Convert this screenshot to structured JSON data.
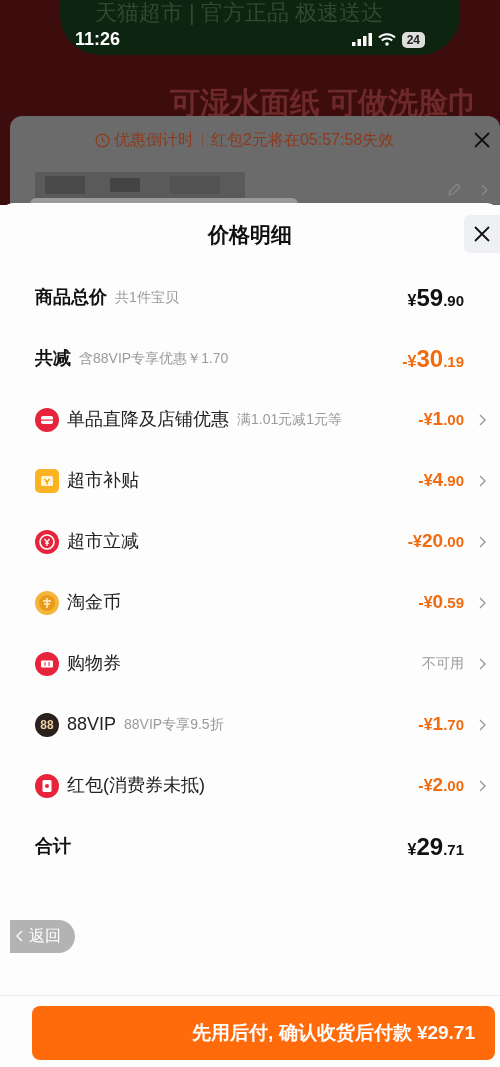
{
  "status_bar": {
    "time": "11:26",
    "battery": "24"
  },
  "background": {
    "banner_top": "天猫超市 | 官方正品 极速送达",
    "slogan": "可湿水面纸 可做洗脸巾"
  },
  "notice": {
    "label": "优惠倒计时",
    "text": "红包2元将在05:57:58失效"
  },
  "sheet": {
    "title": "价格明细",
    "rows": [
      {
        "kind": "summary",
        "label": "商品总价",
        "note": "共1件宝贝",
        "amount": "¥59.90",
        "discount": false,
        "chevron": false
      },
      {
        "kind": "summary",
        "label": "共减",
        "note": "含88VIP专享优惠￥1.70",
        "amount": "-¥30.19",
        "discount": true,
        "chevron": false
      },
      {
        "kind": "store",
        "label": "单品直降及店铺优惠",
        "note": "满1.01元减1元等",
        "amount": "-¥1.00",
        "discount": true,
        "chevron": true
      },
      {
        "kind": "subsidy",
        "label": "超市补贴",
        "amount": "-¥4.90",
        "discount": true,
        "chevron": true
      },
      {
        "kind": "instant",
        "label": "超市立减",
        "amount": "-¥20.00",
        "discount": true,
        "chevron": true
      },
      {
        "kind": "coin",
        "label": "淘金币",
        "amount": "-¥0.59",
        "discount": true,
        "chevron": true
      },
      {
        "kind": "ticket",
        "label": "购物券",
        "status": "不可用",
        "chevron": true
      },
      {
        "kind": "vip",
        "icon_text": "88",
        "label": "88VIP",
        "note": "88VIP专享9.5折",
        "amount": "-¥1.70",
        "discount": true,
        "chevron": true
      },
      {
        "kind": "packet",
        "label": "红包(消费券未抵)",
        "amount": "-¥2.00",
        "discount": true,
        "chevron": true
      },
      {
        "kind": "summary",
        "label": "合计",
        "amount": "¥29.71",
        "discount": false,
        "chevron": false
      }
    ],
    "back": "返回",
    "pay_button": "先用后付, 确认收货后付款 ¥29.71"
  }
}
